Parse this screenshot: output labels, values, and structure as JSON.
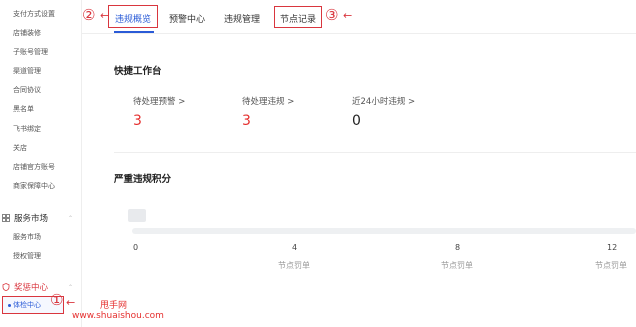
{
  "sidebar": {
    "items": [
      {
        "label": "支付方式设置"
      },
      {
        "label": "店铺装修"
      },
      {
        "label": "子账号管理"
      },
      {
        "label": "渠道管理"
      },
      {
        "label": "合同协议"
      },
      {
        "label": "黑名单"
      },
      {
        "label": "飞书绑定"
      },
      {
        "label": "关店"
      },
      {
        "label": "店铺官方账号"
      },
      {
        "label": "商家保障中心"
      }
    ],
    "service_group": {
      "label": "服务市场",
      "items": [
        {
          "label": "服务市场"
        },
        {
          "label": "授权管理"
        }
      ]
    },
    "reward_group": {
      "label": "奖惩中心"
    },
    "active_item": {
      "label": "体检中心"
    }
  },
  "tabs": [
    {
      "label": "违规概览"
    },
    {
      "label": "预警中心"
    },
    {
      "label": "违规管理"
    },
    {
      "label": "节点记录"
    }
  ],
  "annotations": {
    "n1": "①",
    "n2": "②",
    "n3": "③",
    "arrow": "←"
  },
  "workbench": {
    "title": "快捷工作台",
    "stats": [
      {
        "label": "待处理预警",
        "value": "3",
        "chevron": ">"
      },
      {
        "label": "待处理违规",
        "value": "3",
        "chevron": ">"
      },
      {
        "label": "近24小时违规",
        "value": "0",
        "chevron": ">"
      }
    ]
  },
  "score": {
    "title": "严重违规积分",
    "ticks": [
      {
        "num": "0",
        "sub": ""
      },
      {
        "num": "4",
        "sub": "节点罚单"
      },
      {
        "num": "8",
        "sub": "节点罚单"
      },
      {
        "num": "12",
        "sub": "节点罚单"
      }
    ]
  },
  "watermark": {
    "line1": "甩手网",
    "line2": "www.shuaishou.com"
  },
  "colors": {
    "accent": "#2a5bd7",
    "alert": "#e5302f",
    "annotation": "#d9363e"
  }
}
